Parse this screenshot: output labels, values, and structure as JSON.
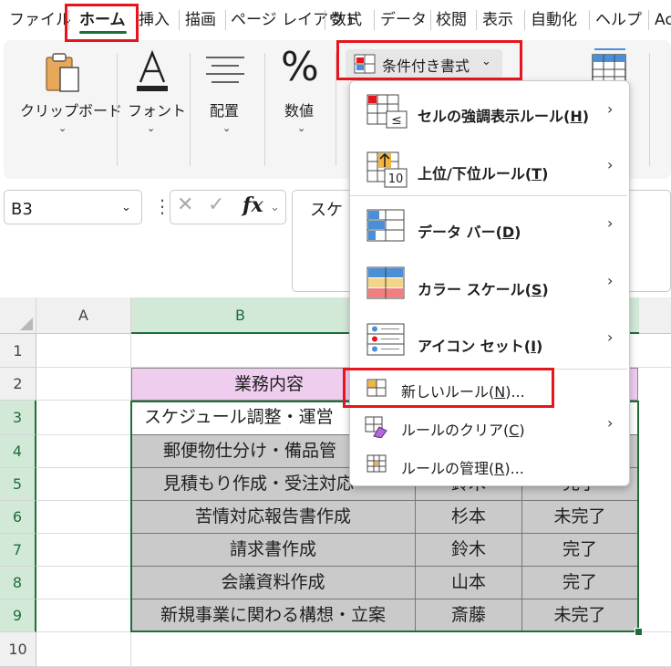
{
  "tabs": [
    {
      "label": "ファイル"
    },
    {
      "label": "ホーム"
    },
    {
      "label": "挿入"
    },
    {
      "label": "描画"
    },
    {
      "label": "ページ レイアウト"
    },
    {
      "label": "数式"
    },
    {
      "label": "データ"
    },
    {
      "label": "校閲"
    },
    {
      "label": "表示"
    },
    {
      "label": "自動化"
    },
    {
      "label": "ヘルプ"
    },
    {
      "label": "Ac"
    }
  ],
  "ribbon": {
    "clipboard": "クリップボード",
    "font": "フォント",
    "alignment": "配置",
    "number": "数値",
    "conditional_formatting": "条件付き書式"
  },
  "formula_bar": {
    "name_box": "B3",
    "fx": "fx",
    "content": "スケ"
  },
  "columns": [
    "A",
    "B"
  ],
  "rows": [
    "1",
    "2",
    "3",
    "4",
    "5",
    "6",
    "7",
    "8",
    "9",
    "10"
  ],
  "table": {
    "header": "業務内容",
    "rows": [
      {
        "task": "スケジュール調整・運営",
        "person": "",
        "status": ""
      },
      {
        "task": "郵便物仕分け・備品管",
        "person": "",
        "status": ""
      },
      {
        "task": "見積もり作成・受注対応",
        "person": "鈴木",
        "status": "完了"
      },
      {
        "task": "苦情対応報告書作成",
        "person": "杉本",
        "status": "未完了"
      },
      {
        "task": "請求書作成",
        "person": "鈴木",
        "status": "完了"
      },
      {
        "task": "会議資料作成",
        "person": "山本",
        "status": "完了"
      },
      {
        "task": "新規事業に関わる構想・立案",
        "person": "斎藤",
        "status": "未完了"
      }
    ]
  },
  "menu": {
    "highlight_rules": {
      "text": "セルの強調表示ルール(",
      "key": "H",
      "end": ")"
    },
    "top_bottom_rules": {
      "text": "上位/下位ルール(",
      "key": "T",
      "end": ")"
    },
    "data_bars": {
      "text": "データ バー(",
      "key": "D",
      "end": ")"
    },
    "color_scales": {
      "text": "カラー スケール(",
      "key": "S",
      "end": ")"
    },
    "icon_sets": {
      "text": "アイコン セット(",
      "key": "I",
      "end": ")"
    },
    "new_rule": {
      "text": "新しいルール(",
      "key": "N",
      "end": ")..."
    },
    "clear_rules": {
      "text": "ルールのクリア(",
      "key": "C",
      "end": ")"
    },
    "manage_rules": {
      "text": "ルールの管理(",
      "key": "R",
      "end": ")..."
    }
  },
  "colors": {
    "accent_green": "#1e6e3a",
    "highlight_red": "#e8141c",
    "header_pink": "#efcdef",
    "data_gray": "#cacaca"
  }
}
